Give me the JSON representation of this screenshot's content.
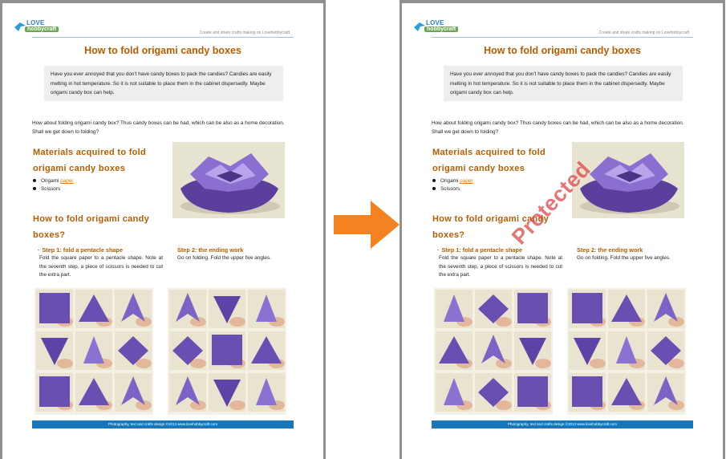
{
  "document": {
    "logo": {
      "love": "LOVE",
      "hobby": "hobbycraft"
    },
    "tagline": "Create and share crafts making on Lovehobbycraft",
    "title": "How to fold origami candy boxes",
    "intro": "Have you ever annoyed that you don't have candy boxes to pack the candies? Candies are easily melting in hot temperature. So it is not suitable to place them in the cabinet dispersedly. Maybe origami candy box can help.",
    "para": "How about folding origami candy box? Thus candy boxes can be had, which can be also as a home decoration. Shall we get down to folding?",
    "materials_heading": "Materials acquired to fold origami candy boxes",
    "materials": {
      "item1_prefix": "Origami",
      "item1_link": "paper",
      "item2": "Scissors"
    },
    "howto_heading": "How to fold origami candy boxes?",
    "step1_title": "Step 1: fold a pentacle shape",
    "step1_text": "Fold the square paper to a pentacle shape. Note at the seventh step, a piece of scissors is needed to cut the extra part.",
    "step2_title": "Step 2: the ending work",
    "step2_text": "Go on folding. Fold the upper five angles.",
    "footer": "Photography, text and crafts design ©2013 www.lovehobbycraft.com"
  },
  "watermark": {
    "text": "Protected",
    "color": "#dd4646"
  },
  "colors": {
    "heading": "#b85c00",
    "link": "#e07b00",
    "footer_bar": "#1976b8",
    "arrow": "#f58220",
    "paper": "#6a4fb3"
  }
}
